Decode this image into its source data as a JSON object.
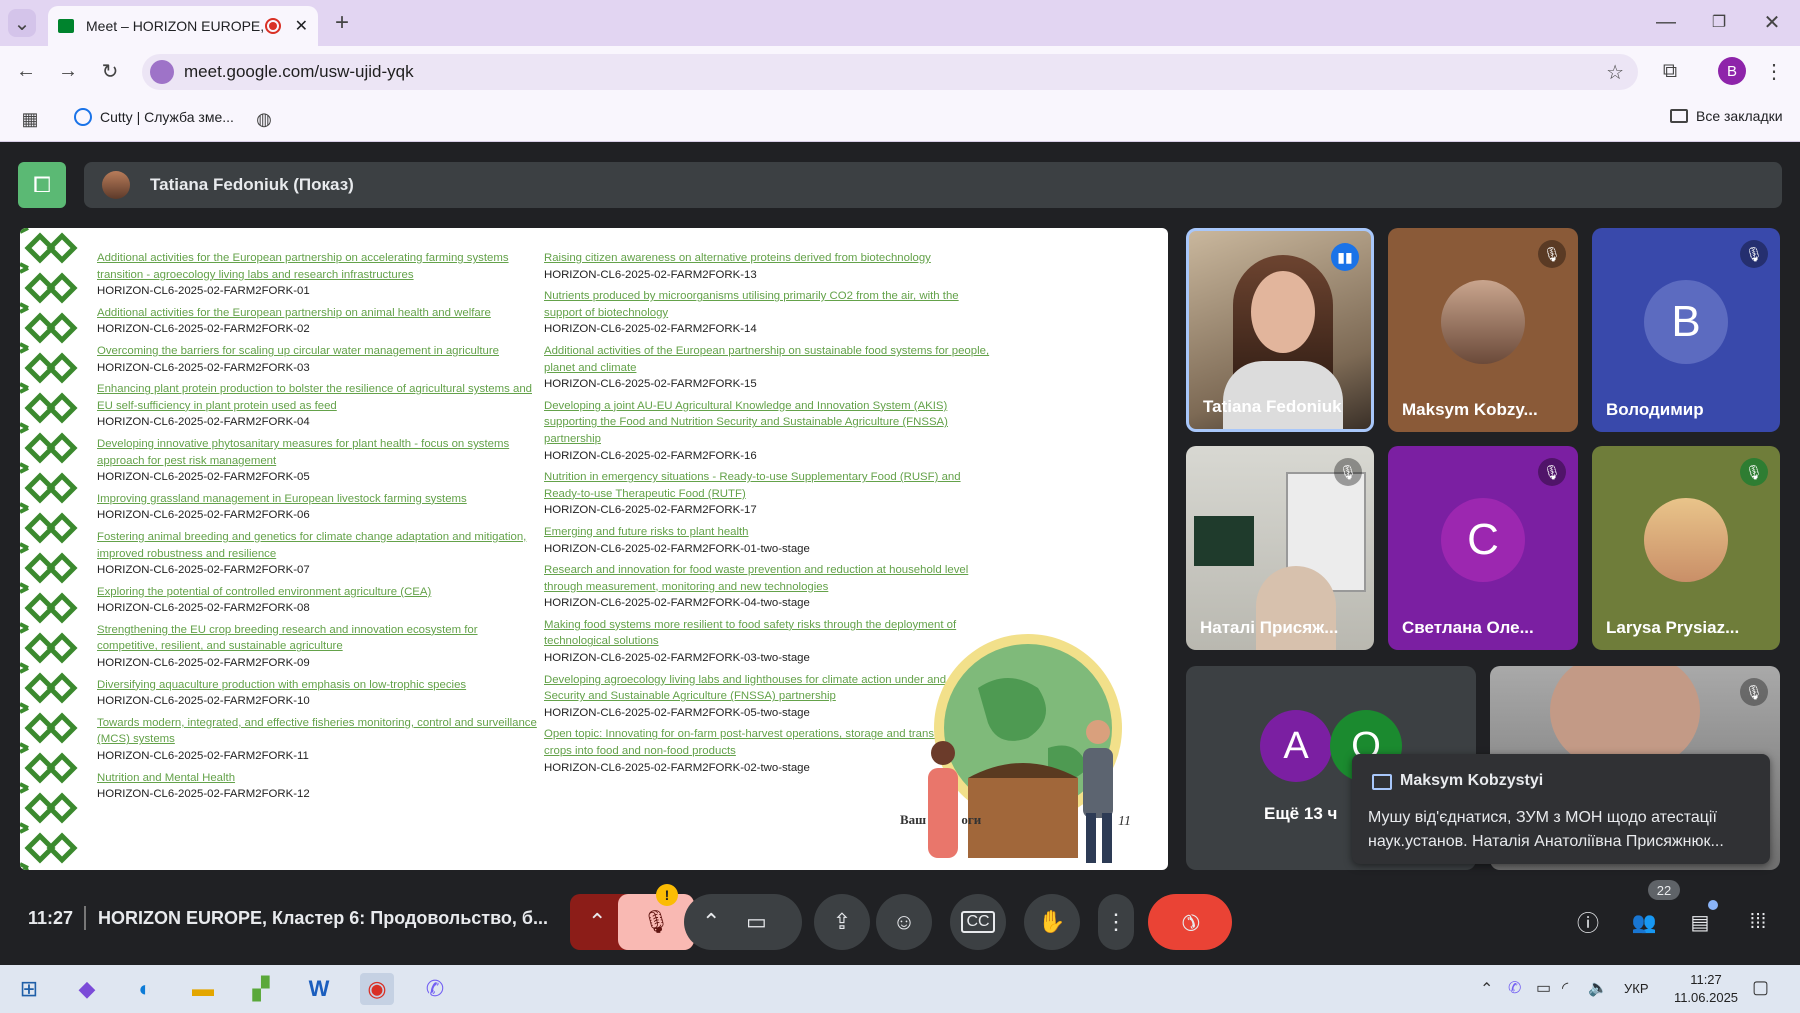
{
  "browser": {
    "tab_title": "Meet – HORIZON EUROPE,",
    "new_tab": "+",
    "url": "meet.google.com/usw-ujid-yqk",
    "profile_letter": "B",
    "bookmark_1": "Cutty | Служба зме...",
    "all_bookmarks": "Все закладки"
  },
  "meet": {
    "presenter_banner": "Tatiana Fedoniuk (Показ)",
    "slide": {
      "left": [
        {
          "title": "Additional activities for the European partnership on accelerating farming systems transition - agroecology living labs and research infrastructures",
          "code": "HORIZON-CL6-2025-02-FARM2FORK-01"
        },
        {
          "title": "Additional activities for the European partnership on animal health and welfare",
          "code": "HORIZON-CL6-2025-02-FARM2FORK-02"
        },
        {
          "title": "Overcoming the barriers for scaling up circular water management in agriculture",
          "code": "HORIZON-CL6-2025-02-FARM2FORK-03"
        },
        {
          "title": "Enhancing plant protein production to bolster the resilience of agricultural systems and EU self-sufficiency in plant protein used as feed",
          "code": "HORIZON-CL6-2025-02-FARM2FORK-04"
        },
        {
          "title": "Developing innovative phytosanitary measures for plant health - focus on systems approach for pest risk management",
          "code": "HORIZON-CL6-2025-02-FARM2FORK-05"
        },
        {
          "title": "Improving grassland management in European livestock farming systems",
          "code": "HORIZON-CL6-2025-02-FARM2FORK-06"
        },
        {
          "title": "Fostering animal breeding and genetics for climate change adaptation and mitigation, improved robustness and resilience",
          "code": "HORIZON-CL6-2025-02-FARM2FORK-07"
        },
        {
          "title": "Exploring the potential of controlled environment agriculture (CEA)",
          "code": "HORIZON-CL6-2025-02-FARM2FORK-08"
        },
        {
          "title": "Strengthening the EU crop breeding research and innovation ecosystem for competitive, resilient, and sustainable agriculture",
          "code": "HORIZON-CL6-2025-02-FARM2FORK-09"
        },
        {
          "title": "Diversifying aquaculture production with emphasis on low-trophic species",
          "code": "HORIZON-CL6-2025-02-FARM2FORK-10"
        },
        {
          "title": "Towards modern, integrated, and effective fisheries monitoring, control and surveillance (MCS) systems",
          "code": "HORIZON-CL6-2025-02-FARM2FORK-11"
        },
        {
          "title": "Nutrition and Mental Health",
          "code": "HORIZON-CL6-2025-02-FARM2FORK-12"
        }
      ],
      "right": [
        {
          "title": "Raising citizen awareness on alternative proteins derived from biotechnology",
          "code": "HORIZON-CL6-2025-02-FARM2FORK-13"
        },
        {
          "title": "Nutrients produced by microorganisms utilising primarily CO2 from the air, with the support of biotechnology",
          "code": "HORIZON-CL6-2025-02-FARM2FORK-14"
        },
        {
          "title": "Additional activities of the European partnership on sustainable food systems for people, planet and climate",
          "code": "HORIZON-CL6-2025-02-FARM2FORK-15"
        },
        {
          "title": "Developing a joint AU-EU Agricultural Knowledge and Innovation System (AKIS) supporting the Food and Nutrition Security and Sustainable Agriculture (FNSSA) partnership",
          "code": "HORIZON-CL6-2025-02-FARM2FORK-16"
        },
        {
          "title": "Nutrition in emergency situations - Ready-to-use Supplementary Food (RUSF) and Ready-to-use Therapeutic Food (RUTF)",
          "code": "HORIZON-CL6-2025-02-FARM2FORK-17"
        },
        {
          "title": "Emerging and future risks to plant health",
          "code": "HORIZON-CL6-2025-02-FARM2FORK-01-two-stage"
        },
        {
          "title": "Research and innovation for food waste prevention and reduction at household level through measurement, monitoring and new technologies",
          "code": "HORIZON-CL6-2025-02-FARM2FORK-04-two-stage"
        },
        {
          "title": "Making food systems more resilient to food safety risks through the deployment of technological solutions",
          "code": "HORIZON-CL6-2025-02-FARM2FORK-03-two-stage"
        },
        {
          "title": "Developing agroecology living labs and lighthouses for climate action under and Nutrition Security and Sustainable Agriculture (FNSSA) partnership",
          "code": "HORIZON-CL6-2025-02-FARM2FORK-05-two-stage"
        },
        {
          "title": "Open topic: Innovating for on-farm post-harvest operations, storage and transformation of crops into food and non-food products",
          "code": "HORIZON-CL6-2025-02-FARM2FORK-02-two-stage"
        }
      ],
      "footer_text": "Ваш ",
      "footer_text2": "оги",
      "page_num": "11"
    },
    "participants": [
      {
        "name": "Tatiana Fedoniuk"
      },
      {
        "name": "Maksym Kobzy..."
      },
      {
        "name": "Володимир",
        "initial": "B"
      },
      {
        "name": "Наталі Присяж..."
      },
      {
        "name": "Светлана Оле...",
        "initial": "С"
      },
      {
        "name": "Larysa Prysiaz..."
      }
    ],
    "more": {
      "label": "Ещё 13 ч",
      "a": "A",
      "o": "O"
    },
    "chat_popup": {
      "sender": "Maksym Kobzystyi",
      "message": "Мушу від'єднатися, ЗУМ з МОН щодо атестації наук.установ. Наталія Анатоліївна Присяжнюк..."
    },
    "bottom": {
      "time": "11:27",
      "meeting_title": "HORIZON EUROPE, Кластер 6: Продовольство, б...",
      "people_count": "22"
    }
  },
  "taskbar": {
    "lang": "УКР",
    "time": "11:27",
    "date": "11.06.2025"
  },
  "colors": {
    "accent_red": "#ea4335",
    "chrome_tab_bg": "#e2d5f2",
    "slide_link": "#64a24a",
    "meet_bg": "#202124"
  }
}
